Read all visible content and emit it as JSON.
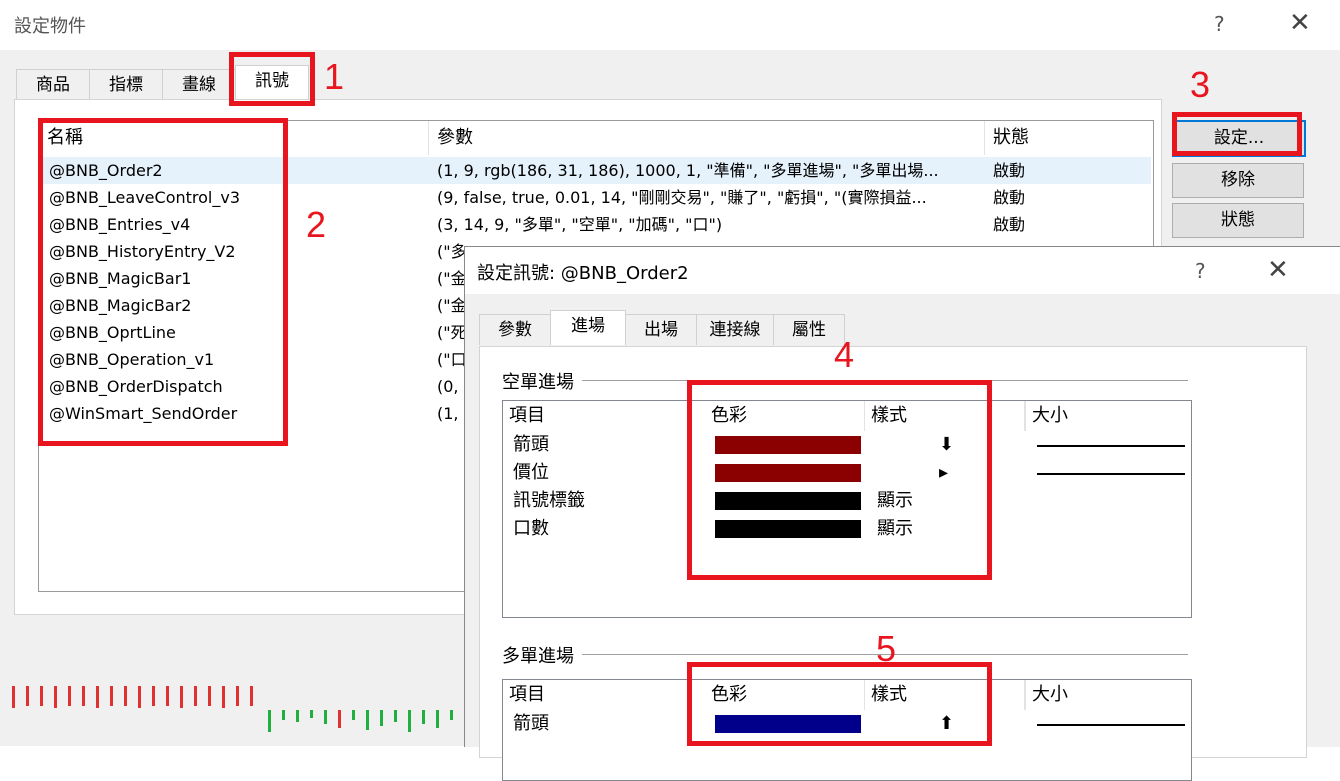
{
  "outer": {
    "title": "設定物件",
    "help": "?",
    "close": "✕",
    "tabs": [
      "商品",
      "指標",
      "畫線",
      "訊號"
    ],
    "columns": [
      "名稱",
      "參數",
      "狀態"
    ],
    "rows": [
      {
        "name": "@BNB_Order2",
        "params": "(1, 9, rgb(186, 31, 186), 1000, 1, \"準備\", \"多單進場\", \"多單出場...",
        "status": "啟動"
      },
      {
        "name": "@BNB_LeaveControl_v3",
        "params": "(9, false, true, 0.01, 14, \"剛剛交易\", \"賺了\", \"虧損\", \"(實際損益...",
        "status": "啟動"
      },
      {
        "name": "@BNB_Entries_v4",
        "params": "(3, 14, 9, \"多單\", \"空單\", \"加碼\", \"口\")",
        "status": "啟動"
      },
      {
        "name": "@BNB_HistoryEntry_V2",
        "params": "(\"多",
        "status": ""
      },
      {
        "name": "@BNB_MagicBar1",
        "params": "(\"金",
        "status": ""
      },
      {
        "name": "@BNB_MagicBar2",
        "params": "(\"金",
        "status": ""
      },
      {
        "name": "@BNB_OprtLine",
        "params": "(\"死",
        "status": ""
      },
      {
        "name": "@BNB_Operation_v1",
        "params": "(\"口",
        "status": ""
      },
      {
        "name": "@BNB_OrderDispatch",
        "params": "(0,",
        "status": ""
      },
      {
        "name": "@WinSmart_SendOrder",
        "params": "(1,",
        "status": ""
      }
    ],
    "buttons": {
      "settings": "設定...",
      "remove": "移除",
      "status": "狀態"
    }
  },
  "inner": {
    "title": "設定訊號: @BNB_Order2",
    "help": "?",
    "close": "✕",
    "tabs": [
      "參數",
      "進場",
      "出場",
      "連接線",
      "屬性"
    ],
    "group1": {
      "label": "空單進場",
      "columns": [
        "項目",
        "色彩",
        "樣式",
        "大小"
      ],
      "items": [
        {
          "name": "箭頭",
          "color": "#8b0000",
          "style": "⬇"
        },
        {
          "name": "價位",
          "color": "#8b0000",
          "style": "▸"
        },
        {
          "name": "訊號標籤",
          "color": "#000000",
          "style": "顯示"
        },
        {
          "name": "口數",
          "color": "#000000",
          "style": "顯示"
        }
      ]
    },
    "group2": {
      "label": "多單進場",
      "columns": [
        "項目",
        "色彩",
        "樣式",
        "大小"
      ],
      "items": [
        {
          "name": "箭頭",
          "color": "#00008b",
          "style": "⬆"
        }
      ]
    }
  },
  "annotations": [
    "1",
    "2",
    "3",
    "4",
    "5"
  ],
  "colors": {
    "annotation": "#e8141e",
    "selection": "#e5f1fb",
    "bar_red": "#e03030",
    "bar_green": "#20b040"
  }
}
